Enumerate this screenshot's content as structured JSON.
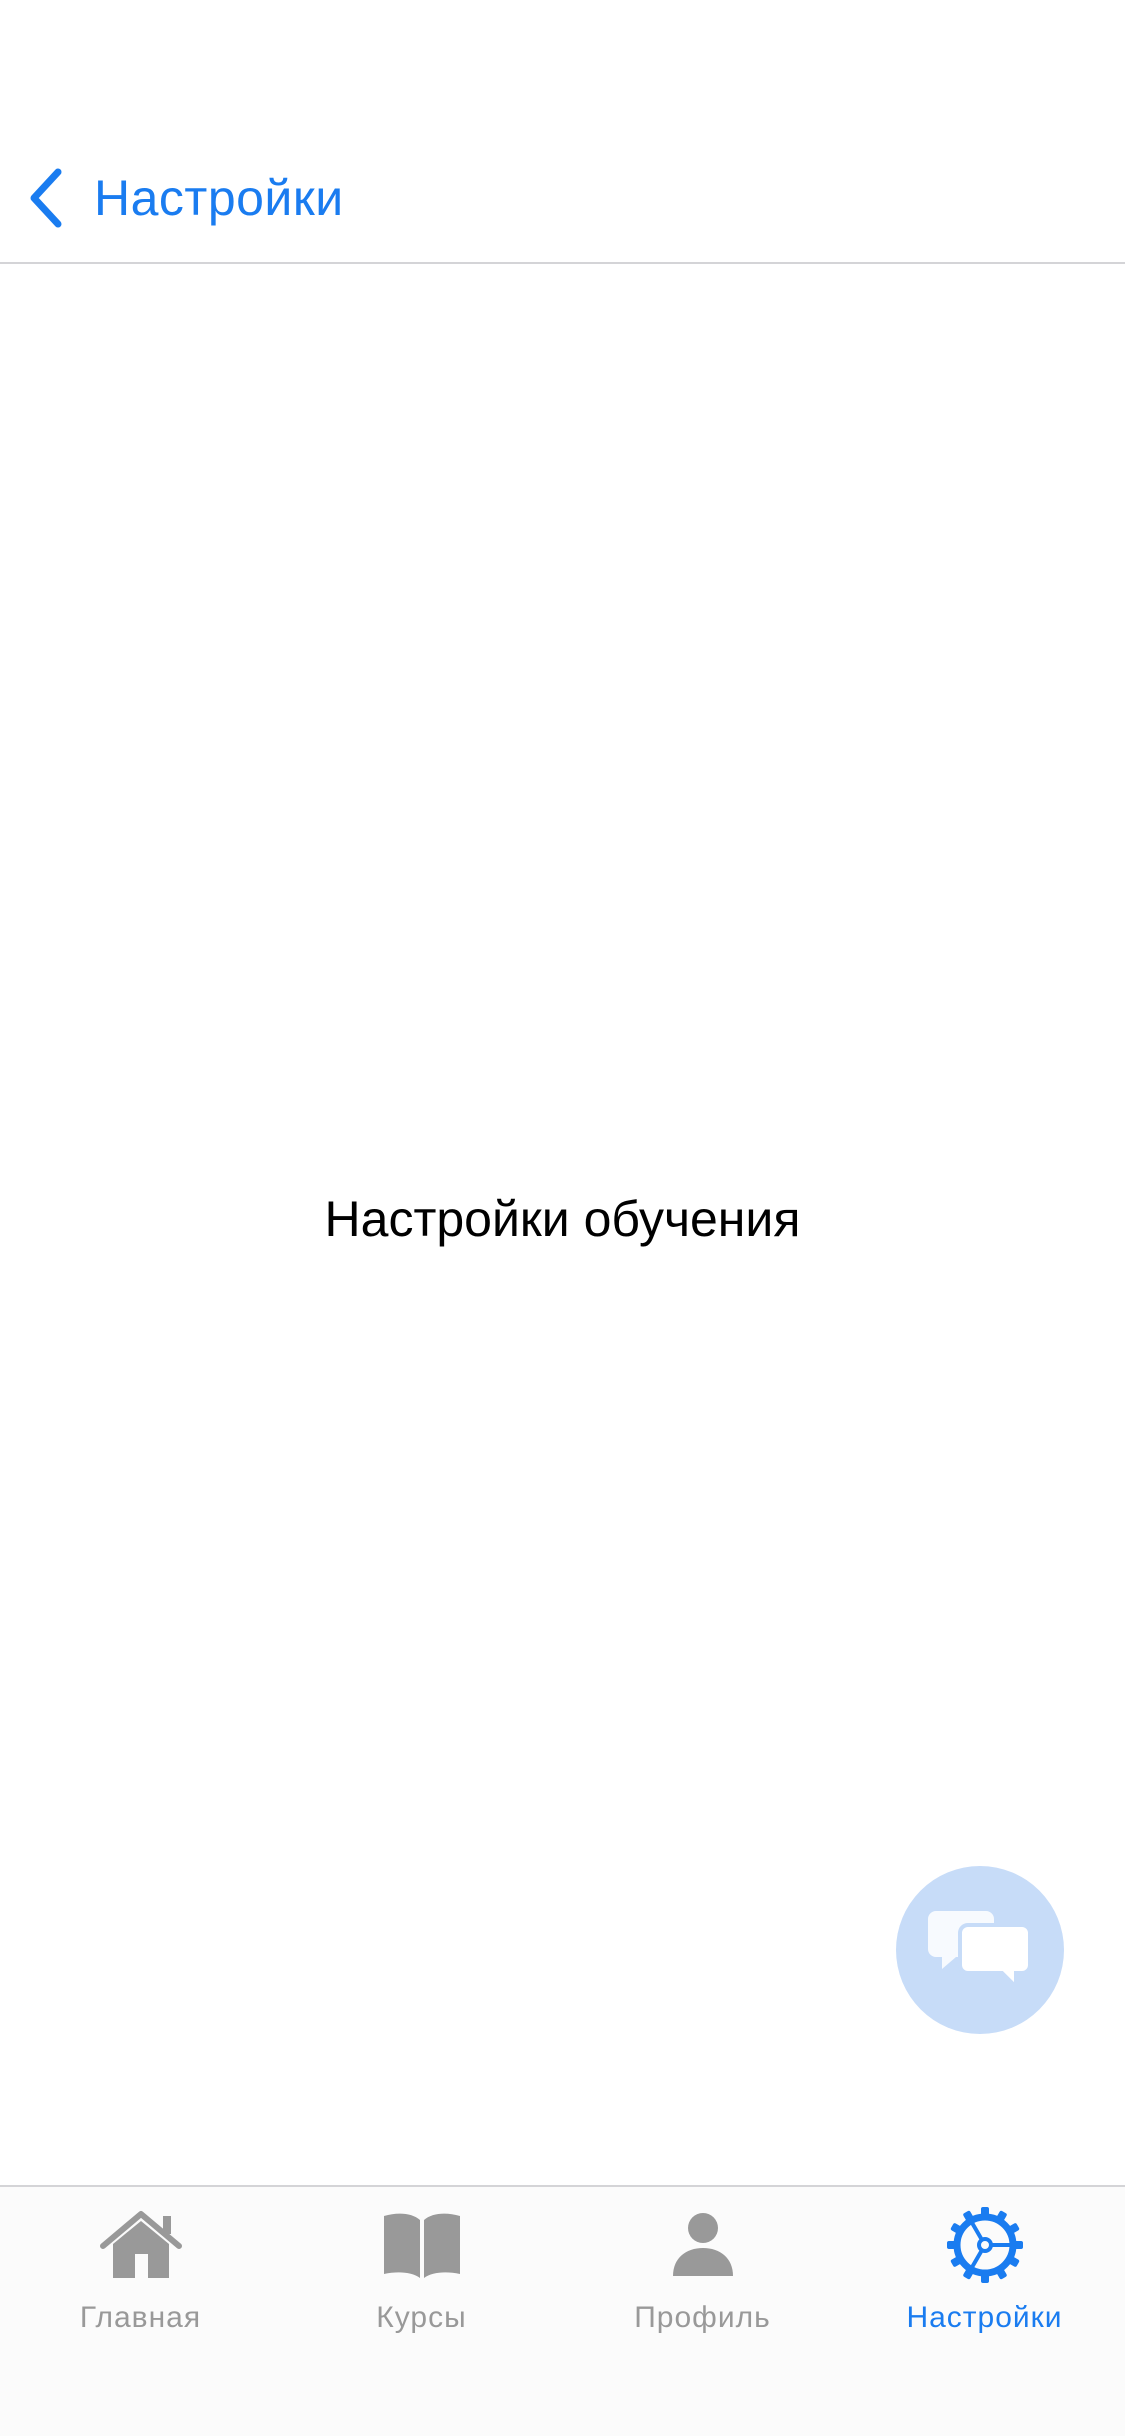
{
  "navbar": {
    "back_label": "Настройки",
    "back_icon": "chevron-left-icon"
  },
  "content": {
    "title": "Настройки обучения"
  },
  "chat_button": {
    "icon": "chat-bubbles-icon"
  },
  "tabbar": {
    "active_index": 3,
    "tabs": [
      {
        "label": "Главная",
        "icon": "home-icon"
      },
      {
        "label": "Курсы",
        "icon": "book-icon"
      },
      {
        "label": "Профиль",
        "icon": "person-icon"
      },
      {
        "label": "Настройки",
        "icon": "gear-icon"
      }
    ]
  },
  "colors": {
    "accent": "#1a7cf0",
    "inactive": "#999999",
    "fab_background": "#c7dcf8",
    "divider": "#d4d4d7"
  }
}
